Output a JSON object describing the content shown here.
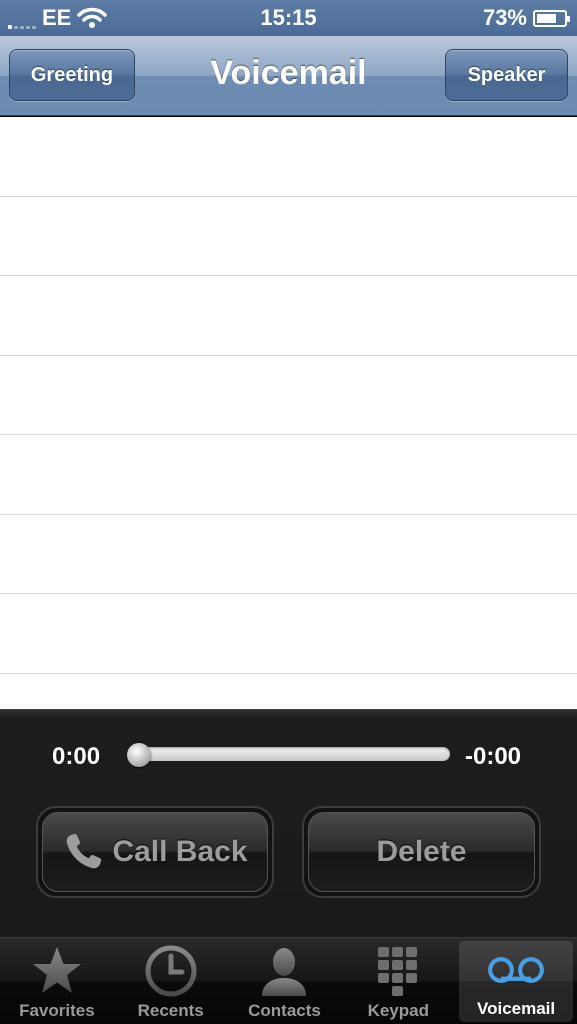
{
  "status_bar": {
    "carrier": "EE",
    "time": "15:15",
    "battery_percent": "73%",
    "battery_level": 0.73
  },
  "nav": {
    "title": "Voicemail",
    "left_button": "Greeting",
    "right_button": "Speaker"
  },
  "voicemail_list": {
    "rows": 7
  },
  "player": {
    "elapsed": "0:00",
    "remaining": "-0:00",
    "progress": 0,
    "call_back_label": "Call Back",
    "delete_label": "Delete"
  },
  "tab_bar": {
    "tabs": [
      {
        "label": "Favorites",
        "icon": "star-icon",
        "active": false
      },
      {
        "label": "Recents",
        "icon": "clock-icon",
        "active": false
      },
      {
        "label": "Contacts",
        "icon": "person-icon",
        "active": false
      },
      {
        "label": "Keypad",
        "icon": "keypad-icon",
        "active": false
      },
      {
        "label": "Voicemail",
        "icon": "voicemail-icon",
        "active": true
      }
    ],
    "active_color": "#4a9ee6",
    "inactive_color": "#9a9a9a"
  }
}
